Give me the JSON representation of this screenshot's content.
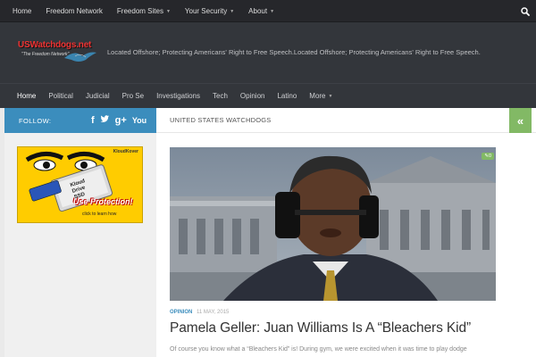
{
  "topnav": {
    "items": [
      {
        "label": "Home",
        "has_dropdown": false
      },
      {
        "label": "Freedom Network",
        "has_dropdown": false
      },
      {
        "label": "Freedom Sites",
        "has_dropdown": true
      },
      {
        "label": "Your Security",
        "has_dropdown": true
      },
      {
        "label": "About",
        "has_dropdown": true
      }
    ],
    "search_icon": "search-icon"
  },
  "header": {
    "logo_text": "USWatchdogs.net",
    "logo_sub": "\"The Freedom Network\"",
    "tagline": "Located Offshore; Protecting Americans' Right to Free Speech.Located Offshore; Protecting Americans' Right to Free Speech."
  },
  "mainnav": {
    "items": [
      {
        "label": "Home",
        "active": true
      },
      {
        "label": "Political"
      },
      {
        "label": "Judicial"
      },
      {
        "label": "Pro Se"
      },
      {
        "label": "Investigations"
      },
      {
        "label": "Tech"
      },
      {
        "label": "Opinion"
      },
      {
        "label": "Latino"
      },
      {
        "label": "More",
        "has_dropdown": true
      }
    ]
  },
  "sidebar": {
    "follow_label": "FOLLOW:",
    "social_icons": [
      "facebook-icon",
      "twitter-icon",
      "google-plus-icon",
      "youtube-icon"
    ],
    "ad": {
      "brand": "KloudKover",
      "drive_label": "Kloud Drive SSD",
      "cta": "Use Protection!",
      "learn": "click to learn how"
    }
  },
  "content": {
    "breadcrumb": "UNITED STATES WATCHDOGS",
    "toggle_icon": "double-chevron-left-icon",
    "post": {
      "comment_count": "0",
      "category": "OPINION",
      "date": "11 MAY, 2015",
      "title": "Pamela Geller: Juan Williams Is A “Bleachers Kid”",
      "excerpt": "Of course you know what a “Bleachers Kid” is! During gym, we were excited when it was time to play dodge"
    }
  },
  "colors": {
    "accent_blue": "#3b8dbd",
    "accent_green": "#82b965",
    "dark_bar": "#26272b",
    "header_bg": "#33363b"
  }
}
